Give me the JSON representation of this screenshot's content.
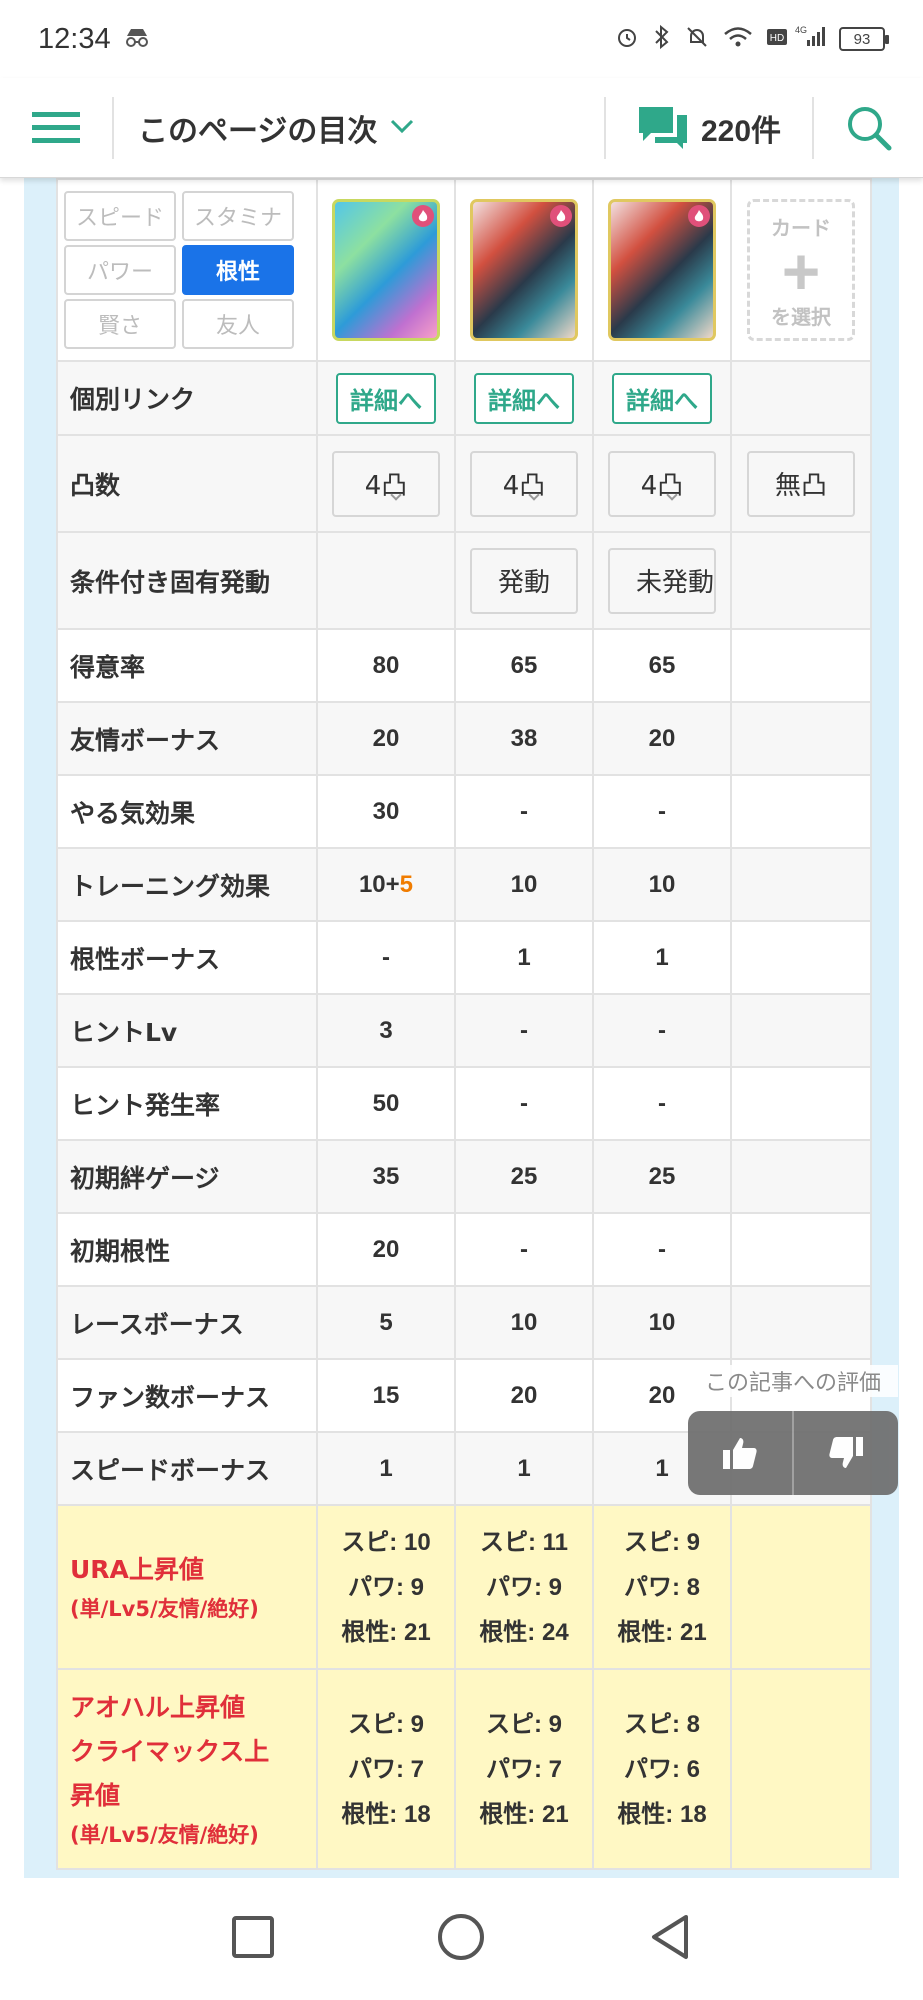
{
  "status_bar": {
    "time": "12:34",
    "battery": "93",
    "network": "4G"
  },
  "header": {
    "toc_label": "このページの目次",
    "comment_count": "220件"
  },
  "filters": {
    "buttons": [
      "スピード",
      "スタミナ",
      "パワー",
      "根性",
      "賢さ",
      "友人"
    ],
    "active": "根性"
  },
  "cards": {
    "select_top": "カード",
    "select_bottom": "を選択"
  },
  "table": {
    "link_label": "個別リンク",
    "link_button": "詳細へ",
    "limit_label": "凸数",
    "limit_values": [
      "4凸",
      "4凸",
      "4凸",
      "無凸"
    ],
    "cond_label": "条件付き固有発動",
    "cond_values": [
      "",
      "発動",
      "未発動",
      ""
    ],
    "rows": [
      {
        "label": "得意率",
        "values": [
          "80",
          "65",
          "65",
          ""
        ]
      },
      {
        "label": "友情ボーナス",
        "values": [
          "20",
          "38",
          "20",
          ""
        ]
      },
      {
        "label": "やる気効果",
        "values": [
          "30",
          "-",
          "-",
          ""
        ]
      },
      {
        "label": "トレーニング効果",
        "values": [
          "10+",
          "10",
          "10",
          ""
        ],
        "extra": "5"
      },
      {
        "label": "根性ボーナス",
        "values": [
          "-",
          "1",
          "1",
          ""
        ]
      },
      {
        "label": "ヒントLv",
        "values": [
          "3",
          "-",
          "-",
          ""
        ]
      },
      {
        "label": "ヒント発生率",
        "values": [
          "50",
          "-",
          "-",
          ""
        ]
      },
      {
        "label": "初期絆ゲージ",
        "values": [
          "35",
          "25",
          "25",
          ""
        ]
      },
      {
        "label": "初期根性",
        "values": [
          "20",
          "-",
          "-",
          ""
        ]
      },
      {
        "label": "レースボーナス",
        "values": [
          "5",
          "10",
          "10",
          ""
        ]
      },
      {
        "label": "ファン数ボーナス",
        "values": [
          "15",
          "20",
          "20",
          ""
        ]
      },
      {
        "label": "スピードボーナス",
        "values": [
          "1",
          "1",
          "1",
          ""
        ]
      }
    ],
    "ura": {
      "label": "URA上昇値",
      "sub": "(単/Lv5/友情/絶好)",
      "cols": [
        [
          "スピ: 10",
          "パワ: 9",
          "根性: 21"
        ],
        [
          "スピ: 11",
          "パワ: 9",
          "根性: 24"
        ],
        [
          "スピ: 9",
          "パワ: 8",
          "根性: 21"
        ]
      ]
    },
    "aoharu": {
      "label_1": "アオハル上昇値",
      "label_2": "クライマックス上",
      "label_3": "昇値",
      "sub": "(単/Lv5/友情/絶好)",
      "cols": [
        [
          "スピ: 9",
          "パワ: 7",
          "根性: 18"
        ],
        [
          "スピ: 9",
          "パワ: 7",
          "根性: 21"
        ],
        [
          "スピ: 8",
          "パワ: 6",
          "根性: 18"
        ]
      ]
    }
  },
  "rating": {
    "label": "この記事への評価"
  },
  "colors": {
    "accent_green": "#2fa88a",
    "active_blue": "#1a73e8",
    "highlight_orange": "#f07c00",
    "red_label": "#e02f3a",
    "yellow_bg": "#fff8c4"
  }
}
